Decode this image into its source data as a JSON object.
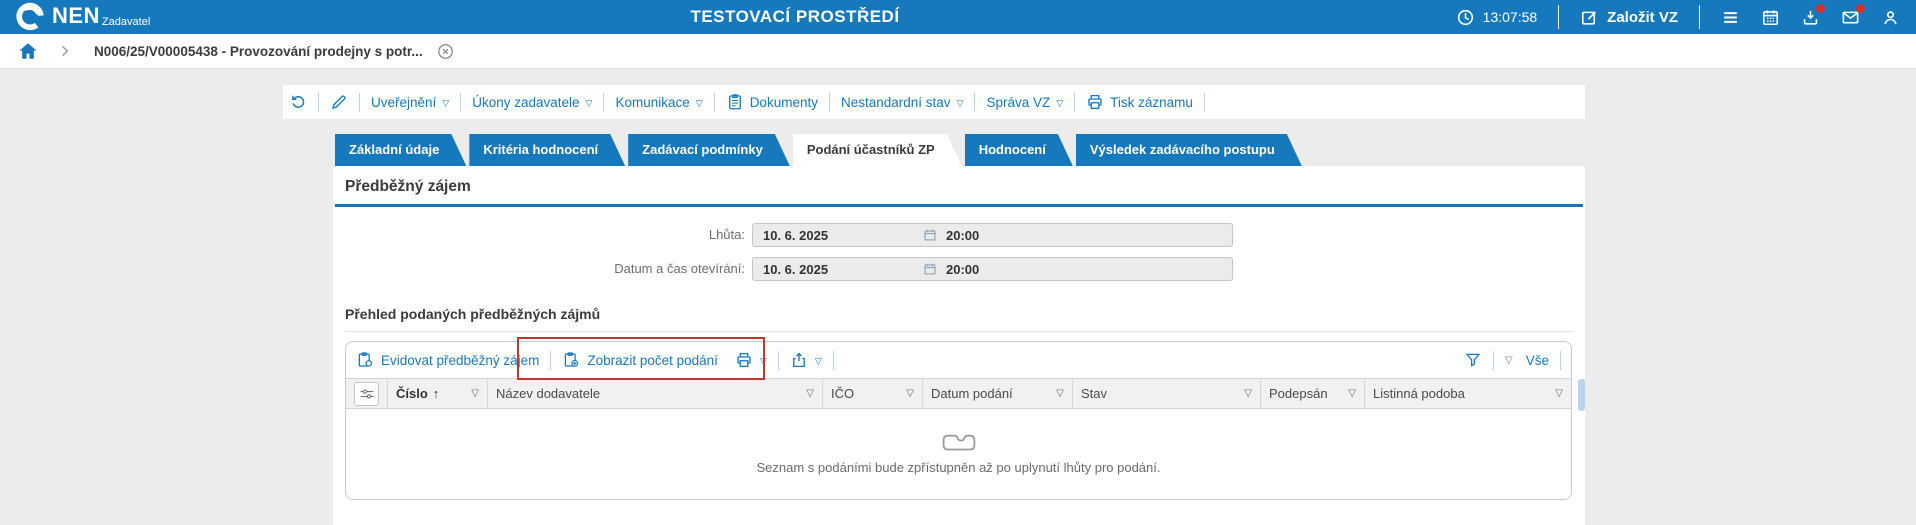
{
  "topbar": {
    "logo_text": "NEN",
    "logo_subtitle": "Zadavatel",
    "env_title": "TESTOVACÍ PROSTŘEDÍ",
    "clock": "13:07:58",
    "create_label": "Založit VZ"
  },
  "breadcrumb": {
    "item": "N006/25/V00005438 - Provozování prodejny s potr..."
  },
  "toolbar": {
    "items": [
      {
        "label": "Uveřejnění",
        "dropdown": true
      },
      {
        "label": "Úkony zadavatele",
        "dropdown": true
      },
      {
        "label": "Komunikace",
        "dropdown": true
      },
      {
        "label": "Dokumenty",
        "dropdown": false,
        "icon": "document-icon"
      },
      {
        "label": "Nestandardní stav",
        "dropdown": true
      },
      {
        "label": "Správa VZ",
        "dropdown": true
      },
      {
        "label": "Tisk záznamu",
        "dropdown": false,
        "icon": "printer-icon"
      }
    ]
  },
  "tabs": [
    {
      "label": "Základní údaje",
      "active": false
    },
    {
      "label": "Kritéria hodnocení",
      "active": false
    },
    {
      "label": "Zadávací podmínky",
      "active": false
    },
    {
      "label": "Podání účastníků ZP",
      "active": true
    },
    {
      "label": "Hodnocení",
      "active": false
    },
    {
      "label": "Výsledek zadávacího postupu",
      "active": false
    }
  ],
  "section": {
    "title": "Předběžný zájem"
  },
  "form": {
    "rows": [
      {
        "label": "Lhůta:",
        "date": "10. 6. 2025",
        "time": "20:00"
      },
      {
        "label": "Datum a čas otevírání:",
        "date": "10. 6. 2025",
        "time": "20:00"
      }
    ]
  },
  "grid": {
    "title": "Přehled podaných předběžných zájmů",
    "actions": [
      {
        "label": "Evidovat předběžný zájem",
        "highlighted": false
      },
      {
        "label": "Zobrazit počet podání",
        "highlighted": true
      }
    ],
    "filter_all": "Vše",
    "columns": [
      {
        "label": "",
        "icon": "column-chooser-icon"
      },
      {
        "label": "Číslo",
        "sorted": "asc"
      },
      {
        "label": "Název dodavatele"
      },
      {
        "label": "IČO"
      },
      {
        "label": "Datum podání"
      },
      {
        "label": "Stav"
      },
      {
        "label": "Podepsán"
      },
      {
        "label": "Listinná podoba"
      }
    ],
    "empty_message": "Seznam s podáními bude zpřístupněn až po uplynutí lhůty pro podání."
  },
  "icons": {
    "dropdown_glyph": "▽",
    "sort_asc_glyph": "↑"
  },
  "colors": {
    "topbar_blue": "#1779BD",
    "link_blue": "#1878BE",
    "badge_red": "#D2342B",
    "annotation_red": "#C2362C"
  }
}
